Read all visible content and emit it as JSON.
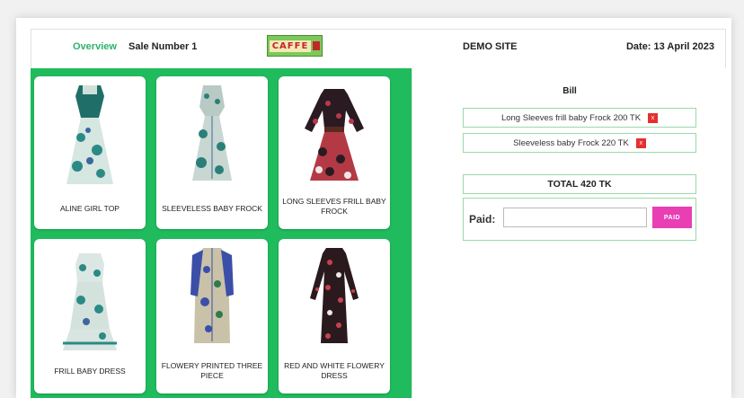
{
  "header": {
    "nav_overview": "Overview",
    "sale_number": "Sale Number 1",
    "logo_text": "CAFFE",
    "site_name": "DEMO SITE",
    "date": "Date: 13 April 2023"
  },
  "products": [
    {
      "label": "ALINE GIRL TOP"
    },
    {
      "label": "SLEEVELESS BABY FROCK"
    },
    {
      "label": "LONG SLEEVES FRILL BABY FROCK"
    },
    {
      "label": "FRILL BABY DRESS"
    },
    {
      "label": "FLOWERY PRINTED THREE PIECE"
    },
    {
      "label": "RED AND WHITE FLOWERY DRESS"
    }
  ],
  "bill": {
    "title": "Bill",
    "items": [
      {
        "text": "Long Sleeves frill baby Frock 200 TK",
        "remove": "x"
      },
      {
        "text": "Sleeveless baby Frock 220 TK",
        "remove": "x"
      }
    ],
    "total": "TOTAL 420 TK",
    "paid_label": "Paid:",
    "paid_value": "",
    "paid_button": "PAID"
  },
  "colors": {
    "accent_green": "#1fbb5c",
    "overview_green": "#2bb36a",
    "paid_button": "#e83fb5",
    "remove_red": "#e53030"
  }
}
